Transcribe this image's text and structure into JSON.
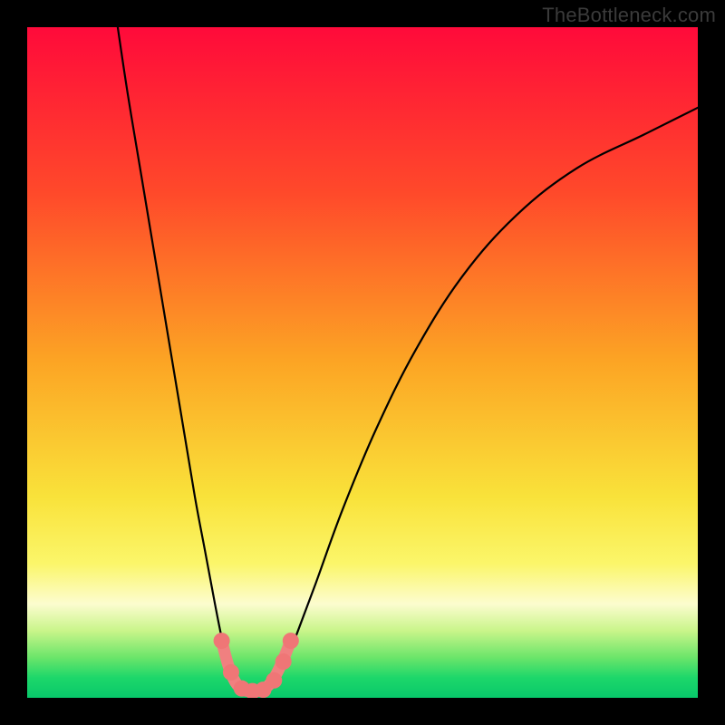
{
  "watermark": "TheBottleneck.com",
  "chart_data": {
    "type": "line",
    "title": "",
    "xlabel": "",
    "ylabel": "",
    "xlim": [
      0,
      100
    ],
    "ylim": [
      0,
      100
    ],
    "background_gradient": {
      "stops": [
        {
          "offset": 0.0,
          "color": "#ff0a3a"
        },
        {
          "offset": 0.25,
          "color": "#ff4a2a"
        },
        {
          "offset": 0.5,
          "color": "#fca524"
        },
        {
          "offset": 0.7,
          "color": "#f9e23a"
        },
        {
          "offset": 0.8,
          "color": "#fbf66a"
        },
        {
          "offset": 0.86,
          "color": "#fcfccf"
        },
        {
          "offset": 0.9,
          "color": "#c9f58a"
        },
        {
          "offset": 0.94,
          "color": "#6be56a"
        },
        {
          "offset": 0.97,
          "color": "#1dd76a"
        },
        {
          "offset": 1.0,
          "color": "#08c86a"
        }
      ]
    },
    "series": [
      {
        "name": "bottleneck-curve-left",
        "x": [
          13.5,
          15,
          17,
          19,
          21,
          23,
          25,
          26.5,
          28,
          29,
          30,
          31,
          31.8
        ],
        "y": [
          100,
          90,
          78,
          66,
          54,
          42,
          30,
          22,
          14,
          9,
          5,
          2.5,
          1.5
        ]
      },
      {
        "name": "bottleneck-curve-right",
        "x": [
          36.5,
          38,
          40,
          43,
          47,
          52,
          58,
          65,
          73,
          82,
          92,
          100
        ],
        "y": [
          1.5,
          4,
          9,
          17,
          28,
          40,
          52,
          63,
          72,
          79,
          84,
          88
        ]
      },
      {
        "name": "pink-u-segment",
        "x": [
          29.0,
          30.0,
          31.0,
          32.0,
          33.0,
          34.2,
          35.3,
          36.3,
          37.3,
          38.3,
          39.3
        ],
        "y": [
          8.5,
          4.8,
          2.4,
          1.3,
          1.0,
          1.0,
          1.3,
          2.2,
          3.8,
          6.0,
          8.5
        ],
        "color": "#f08080",
        "marker_x": [
          29.0,
          30.4,
          32.0,
          33.6,
          35.2,
          36.8,
          38.2,
          39.3
        ],
        "marker_y": [
          8.5,
          3.8,
          1.4,
          1.0,
          1.2,
          2.6,
          5.4,
          8.5
        ]
      }
    ]
  }
}
